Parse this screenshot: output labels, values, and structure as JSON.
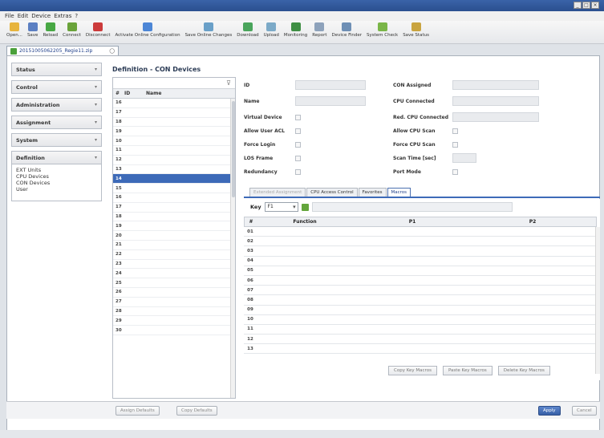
{
  "menu": [
    "File",
    "Edit",
    "Device",
    "Extras",
    "?"
  ],
  "toolbar": [
    {
      "label": "Open...",
      "icon": "folder-icon",
      "color": "#e7b43d"
    },
    {
      "label": "Save",
      "icon": "save-icon",
      "color": "#5b7fc2"
    },
    {
      "label": "Reload",
      "icon": "reload-icon",
      "color": "#48a844"
    },
    {
      "label": "Connect",
      "icon": "connect-icon",
      "color": "#6aa33a"
    },
    {
      "label": "Disconnect",
      "icon": "disconnect-icon",
      "color": "#cc3b3b"
    },
    {
      "label": "Activate Online Configuration",
      "icon": "activate-icon",
      "color": "#4c86d6"
    },
    {
      "label": "Save Online Changes",
      "icon": "save-online-icon",
      "color": "#6aa0c8"
    },
    {
      "label": "Download",
      "icon": "download-icon",
      "color": "#4aa55c"
    },
    {
      "label": "Upload",
      "icon": "upload-icon",
      "color": "#7caac8"
    },
    {
      "label": "Monitoring",
      "icon": "monitoring-icon",
      "color": "#3f8f44"
    },
    {
      "label": "Report",
      "icon": "report-icon",
      "color": "#8da2bb"
    },
    {
      "label": "Device Finder",
      "icon": "device-finder-icon",
      "color": "#6e8fb5"
    },
    {
      "label": "System Check",
      "icon": "system-check-icon",
      "color": "#7ab648"
    },
    {
      "label": "Save Status",
      "icon": "save-status-icon",
      "color": "#c9a440"
    }
  ],
  "doc_tab": {
    "label": "20151005062205_Regie11.zip"
  },
  "nav": [
    {
      "label": "Status"
    },
    {
      "label": "Control"
    },
    {
      "label": "Administration"
    },
    {
      "label": "Assignment"
    },
    {
      "label": "System"
    },
    {
      "label": "Definition"
    }
  ],
  "nav_sub": [
    "EXT Units",
    "CPU Devices",
    "CON Devices",
    "User"
  ],
  "section_title": "Definition - CON Devices",
  "list": {
    "col_id": "ID",
    "col_name": "Name",
    "rows": [
      {
        "no": "16",
        "id": "",
        "name": ""
      },
      {
        "no": "17",
        "id": "",
        "name": ""
      },
      {
        "no": "18",
        "id": "",
        "name": ""
      },
      {
        "no": "19",
        "id": "",
        "name": ""
      },
      {
        "no": "10",
        "id": "",
        "name": ""
      },
      {
        "no": "11",
        "id": "",
        "name": ""
      },
      {
        "no": "12",
        "id": "",
        "name": ""
      },
      {
        "no": "13",
        "id": "",
        "name": ""
      },
      {
        "no": "14",
        "id": "",
        "name": ""
      },
      {
        "no": "15",
        "id": "",
        "name": ""
      },
      {
        "no": "16",
        "id": "",
        "name": ""
      },
      {
        "no": "17",
        "id": "",
        "name": ""
      },
      {
        "no": "18",
        "id": "",
        "name": ""
      },
      {
        "no": "19",
        "id": "",
        "name": ""
      },
      {
        "no": "20",
        "id": "",
        "name": ""
      },
      {
        "no": "21",
        "id": "",
        "name": ""
      },
      {
        "no": "22",
        "id": "",
        "name": ""
      },
      {
        "no": "23",
        "id": "",
        "name": ""
      },
      {
        "no": "24",
        "id": "",
        "name": ""
      },
      {
        "no": "25",
        "id": "",
        "name": ""
      },
      {
        "no": "26",
        "id": "",
        "name": ""
      },
      {
        "no": "27",
        "id": "",
        "name": ""
      },
      {
        "no": "28",
        "id": "",
        "name": ""
      },
      {
        "no": "29",
        "id": "",
        "name": ""
      },
      {
        "no": "30",
        "id": "",
        "name": ""
      }
    ],
    "selected_index": 8
  },
  "props": {
    "id_label": "ID",
    "name_label": "Name",
    "virtual_label": "Virtual Device",
    "allow_user_acl_label": "Allow User ACL",
    "force_login_label": "Force Login",
    "los_frame_label": "LOS Frame",
    "redundancy_label": "Redundancy",
    "con_assigned_label": "CON Assigned",
    "cpu_connected_label": "CPU Connected",
    "red_cpu_label": "Red. CPU Connected",
    "allow_cpu_scan_label": "Allow CPU Scan",
    "force_cpu_scan_label": "Force CPU Scan",
    "scan_time_label": "Scan Time [sec]",
    "port_mode_label": "Port Mode"
  },
  "tabs": [
    {
      "label": "Extended Assignment",
      "state": "faded"
    },
    {
      "label": "CPU Access Control",
      "state": "normal"
    },
    {
      "label": "Favorites",
      "state": "normal"
    },
    {
      "label": "Macros",
      "state": "active"
    }
  ],
  "macros": {
    "key_label": "Key",
    "key_value": "F1",
    "col_no": "#",
    "col_function": "Function",
    "col_p1": "P1",
    "col_p2": "P2",
    "rows": [
      {
        "n": "01",
        "f": "",
        "p1": "",
        "p2": ""
      },
      {
        "n": "02",
        "f": "",
        "p1": "",
        "p2": ""
      },
      {
        "n": "03",
        "f": "",
        "p1": "",
        "p2": ""
      },
      {
        "n": "04",
        "f": "",
        "p1": "",
        "p2": ""
      },
      {
        "n": "05",
        "f": "",
        "p1": "",
        "p2": ""
      },
      {
        "n": "06",
        "f": "",
        "p1": "",
        "p2": ""
      },
      {
        "n": "07",
        "f": "",
        "p1": "",
        "p2": ""
      },
      {
        "n": "08",
        "f": "",
        "p1": "",
        "p2": ""
      },
      {
        "n": "09",
        "f": "",
        "p1": "",
        "p2": ""
      },
      {
        "n": "10",
        "f": "",
        "p1": "",
        "p2": ""
      },
      {
        "n": "11",
        "f": "",
        "p1": "",
        "p2": ""
      },
      {
        "n": "12",
        "f": "",
        "p1": "",
        "p2": ""
      },
      {
        "n": "13",
        "f": "",
        "p1": "",
        "p2": ""
      }
    ],
    "buttons": [
      "Copy Key Macros",
      "Paste Key Macros",
      "Delete Key Macros"
    ]
  },
  "bottom": {
    "left_btn1": "Assign Defaults",
    "left_btn2": "Copy Defaults",
    "apply": "Apply",
    "cancel": "Cancel"
  },
  "colors": {
    "accent": "#3d6ab8",
    "title_blue": "#2b4f90",
    "selection": "#3d6ab8"
  }
}
